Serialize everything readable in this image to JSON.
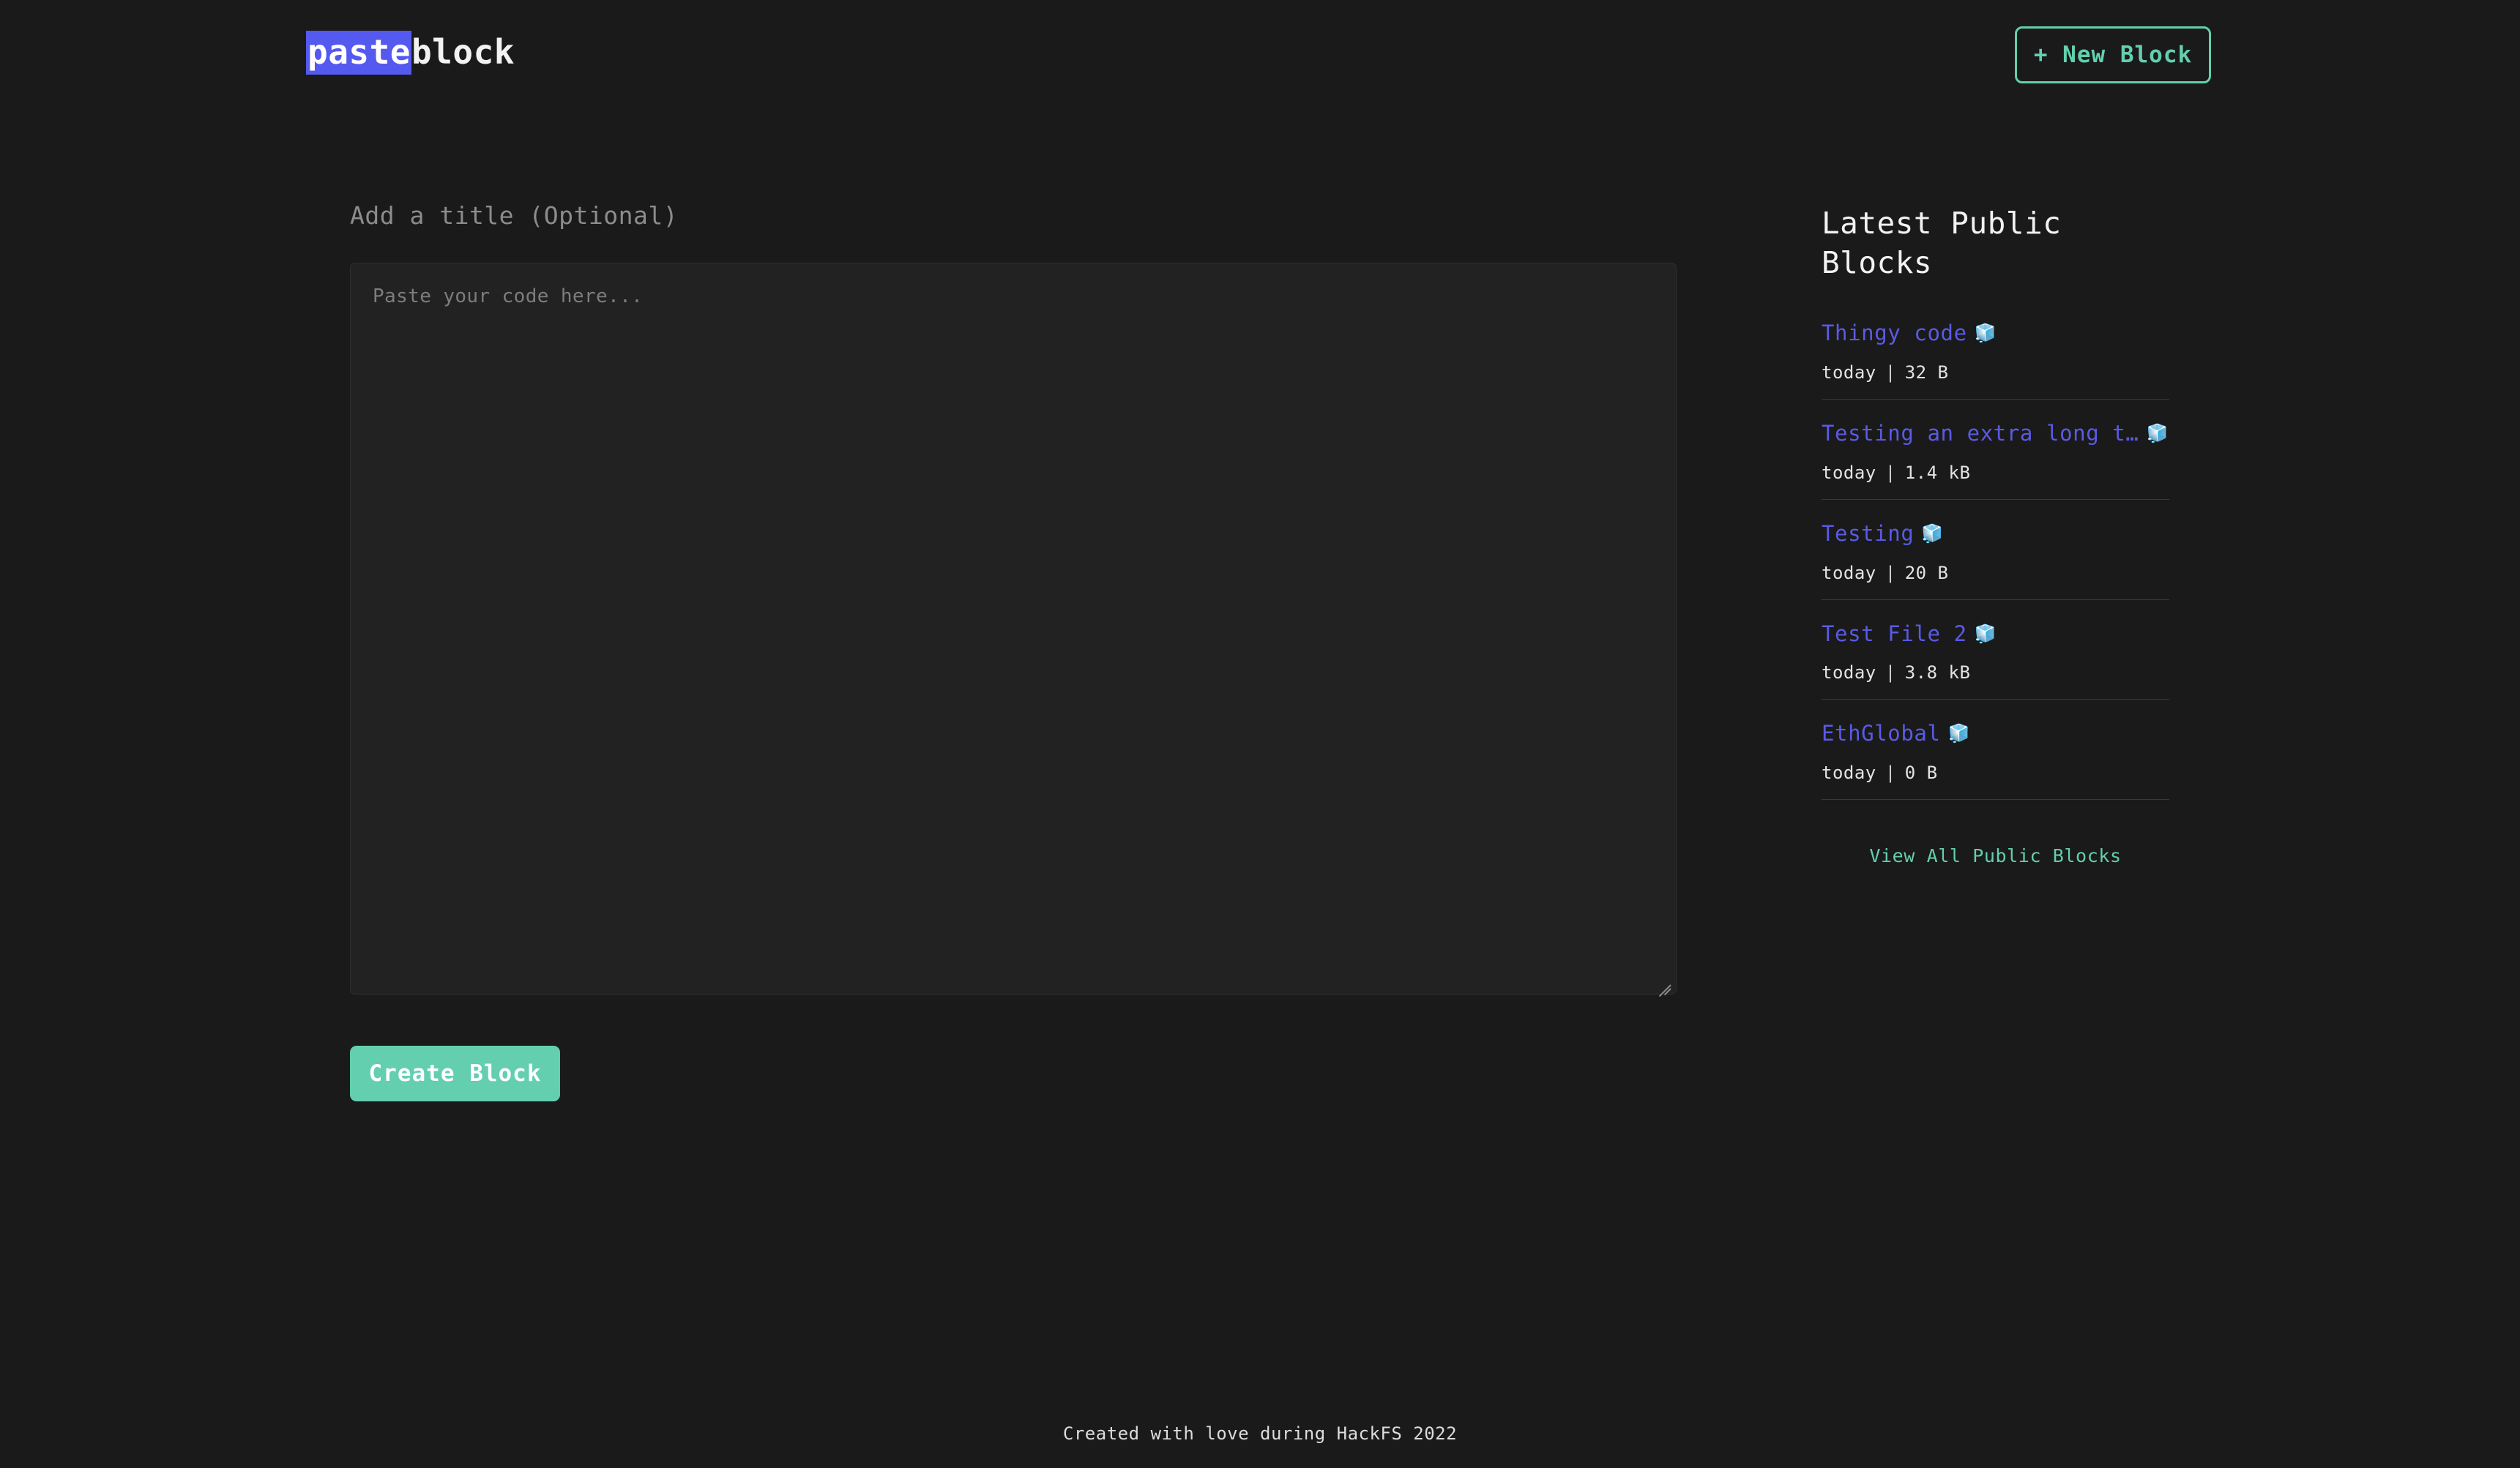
{
  "theme": {
    "page_background": "#1a1a1a",
    "panel_background": "#222222",
    "accent_mint": "#63cfae",
    "accent_blue": "#5459f0",
    "link_blue": "#5a5ae6",
    "divider": "#3a3a3a"
  },
  "header": {
    "brand_accent": "paste",
    "brand_rest": "block",
    "new_block_label": "+ New Block"
  },
  "composer": {
    "title_placeholder": "Add a title (Optional)",
    "title_value": "",
    "code_placeholder": "Paste your code here...",
    "code_value": "",
    "create_button_label": "Create Block",
    "resize_handle_icon": "resize-grip-icon"
  },
  "sidebar": {
    "title": "Latest Public Blocks",
    "cube_icon": "🧊",
    "meta_separator": "|",
    "view_all_label": "View All Public Blocks",
    "blocks": [
      {
        "title": "Thingy code",
        "date": "today",
        "size": "32 B"
      },
      {
        "title": "Testing an extra long t…",
        "date": "today",
        "size": "1.4 kB"
      },
      {
        "title": "Testing",
        "date": "today",
        "size": "20 B"
      },
      {
        "title": "Test File 2",
        "date": "today",
        "size": "3.8 kB"
      },
      {
        "title": "EthGlobal",
        "date": "today",
        "size": "0 B"
      }
    ]
  },
  "footer": {
    "text": "Created with love during HackFS 2022"
  }
}
